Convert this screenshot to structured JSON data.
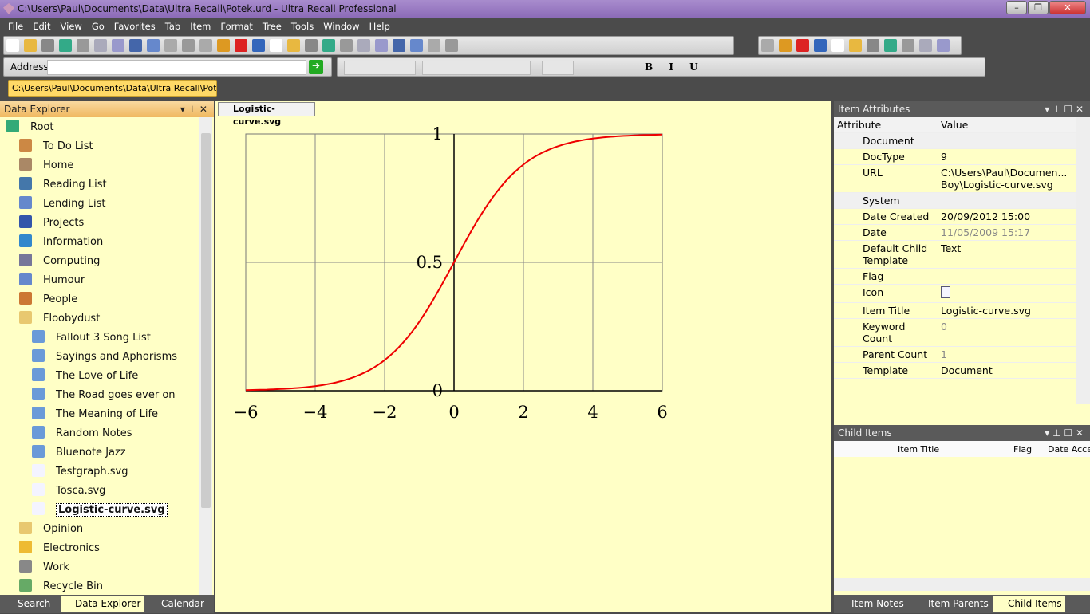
{
  "window": {
    "title": "C:\\Users\\Paul\\Documents\\Data\\Ultra Recall\\Potek.urd - Ultra Recall Professional"
  },
  "menu": [
    "File",
    "Edit",
    "View",
    "Go",
    "Favorites",
    "Tab",
    "Item",
    "Format",
    "Tree",
    "Tools",
    "Window",
    "Help"
  ],
  "address": {
    "label": "Address",
    "value": ""
  },
  "tabbar": {
    "tab": "C:\\Users\\Paul\\Documents\\Data\\Ultra Recall\\Potek"
  },
  "explorer": {
    "title": "Data Explorer",
    "root": "Root",
    "items": [
      {
        "label": "To Do List",
        "icon": "todo",
        "color": "#c84"
      },
      {
        "label": "Home",
        "icon": "home",
        "color": "#a86"
      },
      {
        "label": "Reading List",
        "icon": "book",
        "color": "#47a"
      },
      {
        "label": "Lending List",
        "icon": "note",
        "color": "#68c"
      },
      {
        "label": "Projects",
        "icon": "grid",
        "color": "#35a"
      },
      {
        "label": "Information",
        "icon": "info",
        "color": "#38c"
      },
      {
        "label": "Computing",
        "icon": "computer",
        "color": "#779"
      },
      {
        "label": "Humour",
        "icon": "note",
        "color": "#68c"
      },
      {
        "label": "People",
        "icon": "person",
        "color": "#c73"
      },
      {
        "label": "Floobydust",
        "icon": "folder",
        "color": "#e8c870"
      }
    ],
    "children": [
      "Fallout 3 Song List",
      "Sayings and Aphorisms",
      "The Love of Life",
      "The Road goes ever on",
      "The Meaning of Life",
      "Random Notes",
      "Bluenote Jazz",
      "Testgraph.svg",
      "Tosca.svg",
      "Logistic-curve.svg"
    ],
    "after": [
      {
        "label": "Opinion",
        "icon": "folder",
        "color": "#e8c870"
      },
      {
        "label": "Electronics",
        "icon": "bolt",
        "color": "#eb3"
      },
      {
        "label": "Work",
        "icon": "gear",
        "color": "#888"
      },
      {
        "label": "Recycle Bin",
        "icon": "bin",
        "color": "#6a6"
      }
    ],
    "selected": "Logistic-curve.svg"
  },
  "bottom_tabs": [
    "Search",
    "Data Explorer",
    "Calendar"
  ],
  "document": {
    "tab": "Logistic-curve.svg",
    "x_ticks": [
      "−6",
      "−4",
      "−2",
      "0",
      "2",
      "4",
      "6"
    ],
    "y_ticks": [
      "1",
      "0.5",
      "0"
    ],
    "curve": "1/(1+e^-x)",
    "curve_color": "#ee0000",
    "xlim": [
      -6,
      6
    ],
    "ylim": [
      0,
      1
    ]
  },
  "attributes": {
    "title": "Item Attributes",
    "col_attr": "Attribute",
    "col_value": "Value",
    "rows": [
      {
        "a": "Document",
        "v": "",
        "group": true
      },
      {
        "a": "DocType",
        "v": "9"
      },
      {
        "a": "URL",
        "v": "C:\\Users\\Paul\\Documen... Boy\\Logistic-curve.svg"
      },
      {
        "a": "System",
        "v": "",
        "group": true
      },
      {
        "a": "Date Created",
        "v": "20/09/2012 15:00"
      },
      {
        "a": "Date",
        "v": "11/05/2009 15:17",
        "grey": true
      },
      {
        "a": "Default Child Template",
        "v": "Text"
      },
      {
        "a": "Flag",
        "v": ""
      },
      {
        "a": "Icon",
        "v": ""
      },
      {
        "a": "Item Title",
        "v": "Logistic-curve.svg"
      },
      {
        "a": "Keyword Count",
        "v": "0",
        "grey": true
      },
      {
        "a": "Parent Count",
        "v": "1",
        "grey": true
      },
      {
        "a": "Template",
        "v": "Document"
      }
    ]
  },
  "child_items": {
    "title": "Child Items",
    "columns": [
      "Item Title",
      "Flag",
      "Date Acce"
    ]
  },
  "right_tabs": [
    "Item Notes",
    "Item Parents",
    "Child Items"
  ]
}
